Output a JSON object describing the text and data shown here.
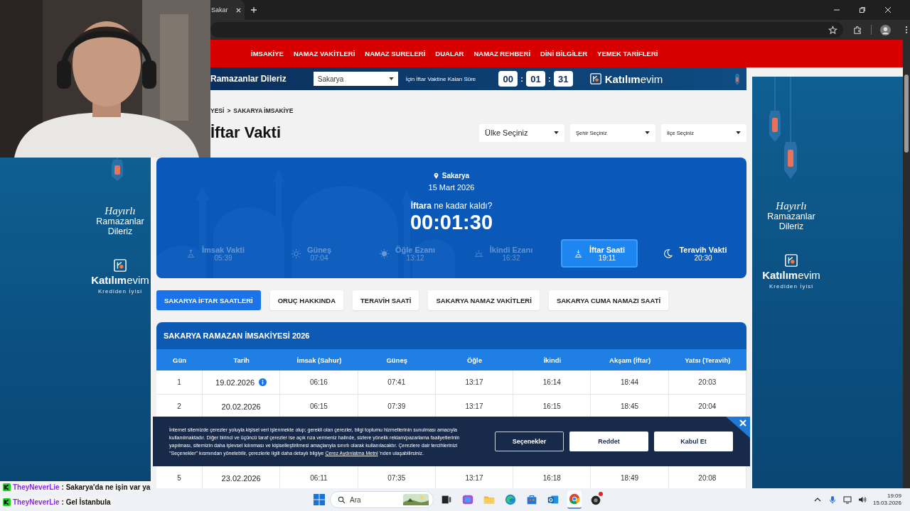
{
  "browser": {
    "tab_title": "Sakar"
  },
  "nav": [
    "İMSAKİYE",
    "NAMAZ VAKİTLERİ",
    "NAMAZ SURELERİ",
    "DUALAR",
    "NAMAZ REHBERİ",
    "DİNİ BİLGİLER",
    "YEMEK TARİFLERİ"
  ],
  "top_banner": {
    "greeting": "Ramazanlar Dileriz",
    "city_select": "Sakarya",
    "countdown_label": "İçin İftar Vaktine Kalan Süre",
    "countdown": [
      "00",
      "01",
      "31"
    ],
    "separator": ":",
    "brand": "**Katılım**evim"
  },
  "breadcrumb": [
    "YESİ",
    "SAKARYA İMSAKİYE"
  ],
  "breadcrumb_separator": ">",
  "title": "İftar Vakti",
  "filters": [
    {
      "label": "Ülke Seçiniz"
    },
    {
      "label": "Şehir Seçiniz"
    },
    {
      "label": "İlçe Seçiniz"
    }
  ],
  "hero": {
    "city": "Sakarya",
    "date": "15 Mart 2026",
    "question": "**İftara** ne kadar kaldı?",
    "countdown": "00:01:30",
    "times": [
      {
        "name": "İmsak Vakti",
        "time": "05:39",
        "kind": "sunrise",
        "passed": true,
        "selected": false
      },
      {
        "name": "Güneş",
        "time": "07:04",
        "kind": "sun",
        "passed": true,
        "selected": false
      },
      {
        "name": "Öğle Ezanı",
        "time": "13:12",
        "kind": "noon",
        "passed": true,
        "selected": false
      },
      {
        "name": "İkindi Ezanı",
        "time": "16:32",
        "kind": "afternoon",
        "passed": true,
        "selected": false
      },
      {
        "name": "İftar Saati",
        "time": "19:11",
        "kind": "sunset",
        "passed": false,
        "selected": true
      },
      {
        "name": "Teravih Vakti",
        "time": "20:30",
        "kind": "moon",
        "passed": false,
        "selected": false
      }
    ]
  },
  "tabs": [
    {
      "label": "SAKARYA İFTAR SAATLERİ",
      "selected": true
    },
    {
      "label": "ORUÇ HAKKINDA",
      "selected": false
    },
    {
      "label": "TERAVİH SAATİ",
      "selected": false
    },
    {
      "label": "SAKARYA NAMAZ VAKİTLERİ",
      "selected": false
    },
    {
      "label": "SAKARYA CUMA NAMAZI SAATİ",
      "selected": false
    }
  ],
  "table": {
    "title": "SAKARYA RAMAZAN İMSAKİYESİ 2026",
    "columns": [
      "Gün",
      "Tarih",
      "İmsak (Sahur)",
      "Güneş",
      "Öğle",
      "İkindi",
      "Akşam (İftar)",
      "Yatsı (Teravih)"
    ],
    "rows_before_banner": [
      {
        "cells": [
          "1",
          "19.02.2026",
          "06:16",
          "07:41",
          "13:17",
          "16:14",
          "18:44",
          "20:03"
        ],
        "info": true
      },
      {
        "cells": [
          "2",
          "20.02.2026",
          "06:15",
          "07:39",
          "13:17",
          "16:15",
          "18:45",
          "20:04"
        ],
        "info": false
      }
    ],
    "rows_after_banner": [
      {
        "cells": [
          "5",
          "23.02.2026",
          "06:11",
          "07:35",
          "13:17",
          "16:18",
          "18:49",
          "20:08"
        ],
        "info": false
      }
    ]
  },
  "cookie_banner": {
    "text": "İnternet sitemizde çerezler yoluyla kişisel veri işlenmekte olup; gerekli olan çerezler, bilgi toplumu hizmetlerinin sunulması amacıyla kullanılmaktadır. Diğer birinci ve üçüncü taraf çerezler ise açık rıza vermeniz halinde, sizlere yönelik reklam/pazarlama faaliyetlerinin yapılması, sitemizin daha işlevsel kılınması ve kişiselleştirilmesi amaçlarıyla sınırlı olarak kullanılacaktır. Çerezlere dair tercihlerinizi \"Seçenekler\" kısmından yönetebilir, çerezlerle ilgili daha detaylı bilgiye",
    "link": "Çerez Aydınlatma Metni",
    "text_end": "'nden ulaşabilirsiniz.",
    "buttons": [
      {
        "label": "Seçenekler",
        "kind": "outline"
      },
      {
        "label": "Reddet",
        "kind": "solid"
      },
      {
        "label": "Kabul Et",
        "kind": "solid"
      }
    ]
  },
  "ads": [
    {
      "script": "Hayırlı",
      "greeting": "Ramazanlar Dileriz",
      "brand": "**Katılım**evim",
      "slogan": "Krediden İyisi"
    },
    {
      "script": "Hayırlı",
      "greeting": "Ramazanlar Dileriz",
      "brand": "**Katılım**evim",
      "slogan": "Krediden İyisi"
    }
  ],
  "chat": [
    {
      "user": "TheyNeverLie",
      "message": ": Sakarya'da ne işin var ya"
    },
    {
      "user": "TheyNeverLie",
      "message": ": Gel İstanbula"
    }
  ],
  "taskbar": {
    "search_placeholder": "Ara",
    "time": "19:09",
    "date": "15.03.2026",
    "apps": [
      {
        "kind": "taskview",
        "active": false,
        "badge": false
      },
      {
        "kind": "m365",
        "active": false,
        "badge": false
      },
      {
        "kind": "folder",
        "active": false,
        "badge": false
      },
      {
        "kind": "edge",
        "active": false,
        "badge": false
      },
      {
        "kind": "store",
        "active": false,
        "badge": false
      },
      {
        "kind": "outlook",
        "active": false,
        "badge": false
      },
      {
        "kind": "chrome",
        "active": true,
        "badge": false
      },
      {
        "kind": "app",
        "active": false,
        "badge": true
      }
    ]
  }
}
